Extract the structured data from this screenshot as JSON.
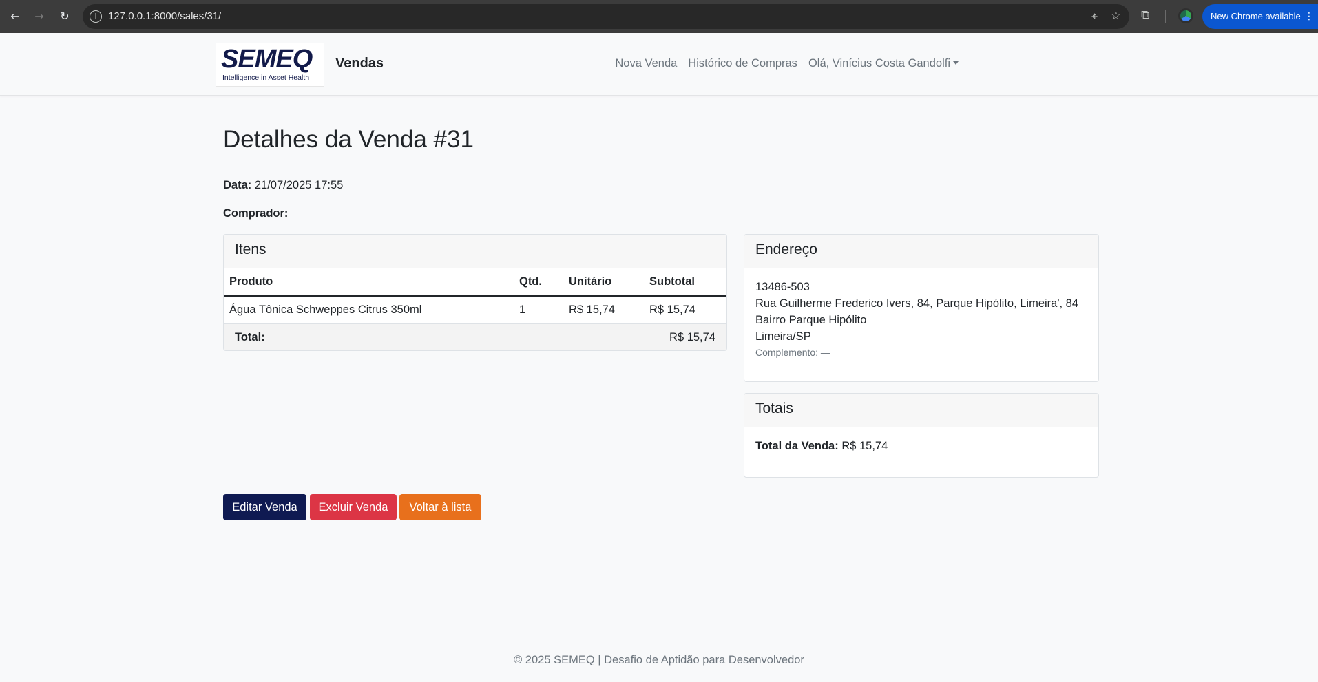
{
  "browser": {
    "url": "127.0.0.1:8000/sales/31/",
    "new_chrome_label": "New Chrome available"
  },
  "navbar": {
    "brand_logo_text": "SEMEQ",
    "brand_tagline": "Intelligence in Asset Health",
    "brand_title": "Vendas",
    "links": [
      "Nova Venda",
      "Histórico de Compras"
    ],
    "user_menu": "Olá, Vinícius Costa Gandolfi"
  },
  "page": {
    "title": "Detalhes da Venda #31",
    "date_label": "Data:",
    "date_value": "21/07/2025 17:55",
    "buyer_label": "Comprador:",
    "buyer_value": ""
  },
  "items": {
    "header": "Itens",
    "columns": [
      "Produto",
      "Qtd.",
      "Unitário",
      "Subtotal"
    ],
    "rows": [
      {
        "produto": "Água Tônica Schweppes Citrus 350ml",
        "qtd": "1",
        "unitario": "R$ 15,74",
        "subtotal": "R$ 15,74"
      }
    ],
    "total_label": "Total:",
    "total_value": "R$ 15,74"
  },
  "address": {
    "header": "Endereço",
    "cep": "13486-503",
    "street": "Rua Guilherme Frederico Ivers, 84, Parque Hipólito, Limeira', 84",
    "district": "Bairro Parque Hipólito",
    "city": "Limeira/SP",
    "complement": "Complemento: —"
  },
  "totals": {
    "header": "Totais",
    "label": "Total da Venda:",
    "value": "R$ 15,74"
  },
  "actions": {
    "edit": "Editar Venda",
    "delete": "Excluir Venda",
    "back": "Voltar à lista"
  },
  "footer": {
    "text": "© 2025 SEMEQ | Desafio de Aptidão para Desenvolvedor"
  },
  "colors": {
    "primary": "#0f1a52",
    "danger": "#dc3545",
    "warning": "#e8701c"
  }
}
